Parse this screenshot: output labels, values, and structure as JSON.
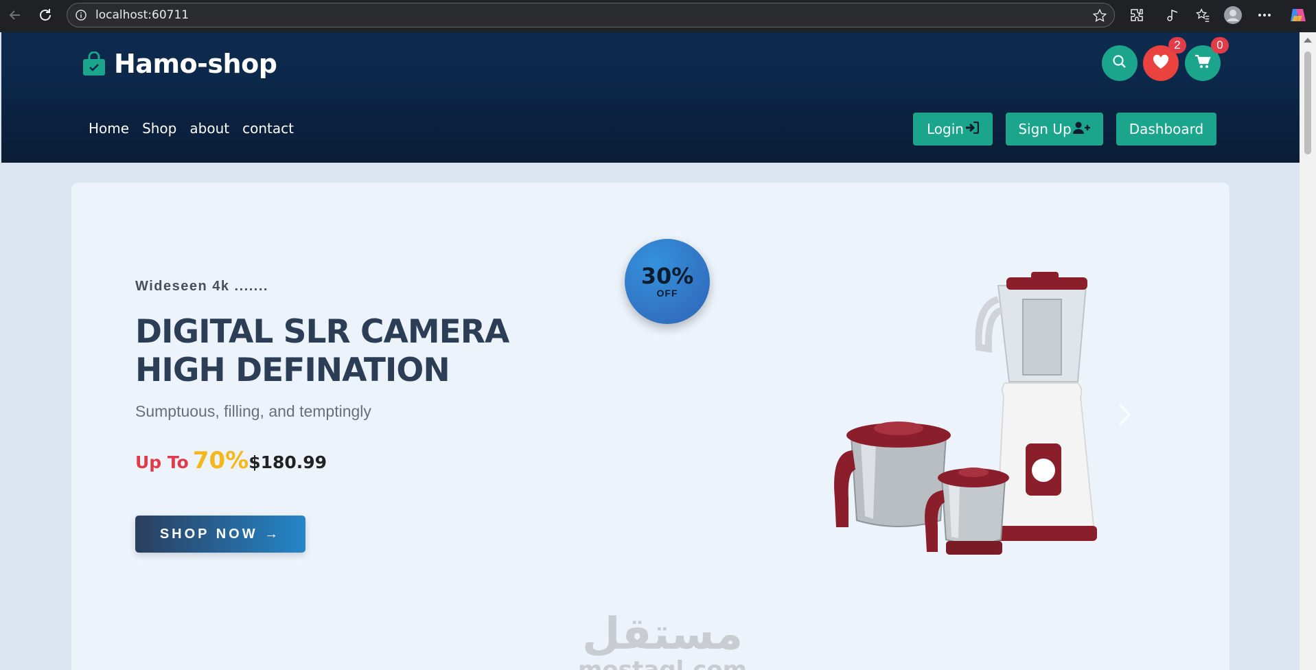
{
  "browser": {
    "url": "localhost:60711"
  },
  "header": {
    "logo_text": "Hamo-shop",
    "wishlist_count": "2",
    "cart_count": "0",
    "nav": [
      "Home",
      "Shop",
      "about",
      "contact"
    ],
    "login_label": "Login",
    "signup_label": "Sign Up",
    "dashboard_label": "Dashboard"
  },
  "hero": {
    "eyebrow": "Wideseen 4k .......",
    "title_line1": "DIGITAL SLR CAMERA",
    "title_line2": "HIGH DEFINATION",
    "subtitle": "Sumptuous, filling, and temptingly",
    "upto_label": "Up To",
    "percent": "70%",
    "price": "$180.99",
    "cta_label": "SHOP NOW →",
    "discount_percent": "30%",
    "discount_off": "OFF"
  },
  "watermark": {
    "arabic": "مستقل",
    "latin": "mostaql.com"
  },
  "colors": {
    "header_bg": "#0c2849",
    "accent_teal": "#1aa58c",
    "wishlist_red": "#e9423f",
    "badge_red": "#e23c48",
    "title_navy": "#2c3e56",
    "price_red": "#e03a4b",
    "price_yellow": "#f4b81a",
    "hero_bg": "#edf3fb",
    "page_bg": "#dbe5f1"
  },
  "icons": {
    "logo": "shopping-bag-check-icon",
    "search": "search-icon",
    "wishlist": "heart-icon",
    "cart": "cart-icon",
    "login": "sign-in-icon",
    "signup": "user-plus-icon",
    "next": "chevron-right-icon"
  }
}
